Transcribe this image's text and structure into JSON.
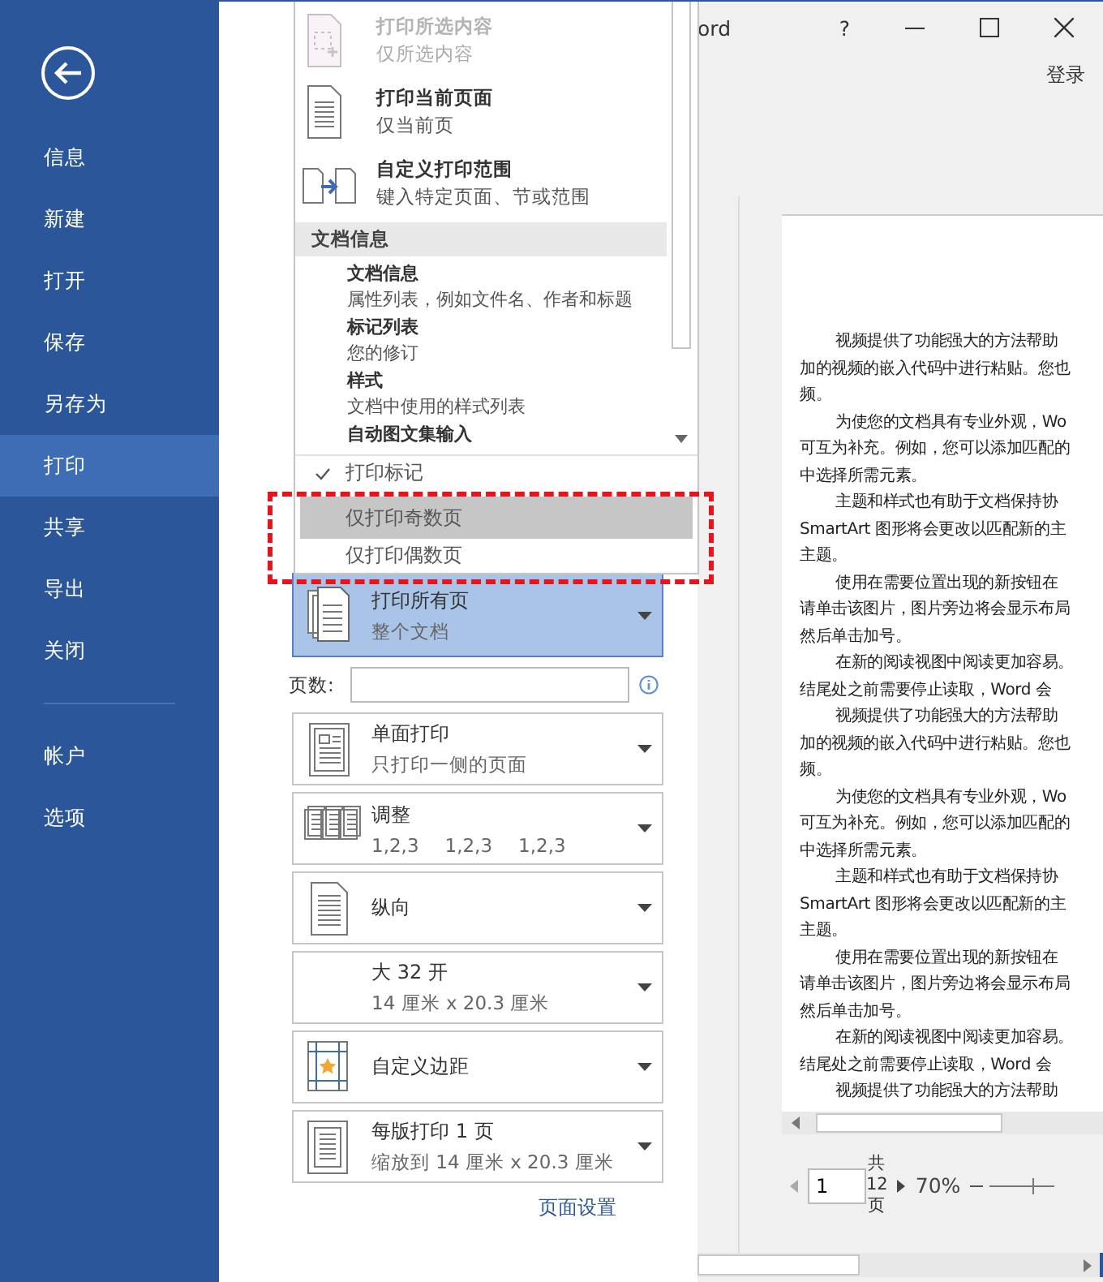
{
  "sidebar": {
    "items": [
      {
        "label": "信息",
        "selected": false
      },
      {
        "label": "新建",
        "selected": false
      },
      {
        "label": "打开",
        "selected": false
      },
      {
        "label": "保存",
        "selected": false
      },
      {
        "label": "另存为",
        "selected": false
      },
      {
        "label": "打印",
        "selected": true
      },
      {
        "label": "共享",
        "selected": false
      },
      {
        "label": "导出",
        "selected": false
      },
      {
        "label": "关闭",
        "selected": false
      }
    ],
    "footer_items": [
      {
        "label": "帐户",
        "selected": false
      },
      {
        "label": "选项",
        "selected": false
      }
    ]
  },
  "title_bar": {
    "title": "ord",
    "help": "?",
    "sign_in": "登录"
  },
  "print_settings": {
    "settings": [
      {
        "title": "打印所有页",
        "subtitle": "整个文档",
        "open": true
      },
      {
        "title": "单面打印",
        "subtitle": "只打印一侧的页面",
        "open": false
      },
      {
        "title": "调整",
        "subtitle_parts": [
          "1,2,3",
          "1,2,3",
          "1,2,3"
        ],
        "open": false
      },
      {
        "title": "纵向",
        "open": false
      },
      {
        "title": "大 32 开",
        "subtitle": "14 厘米 x 20.3 厘米",
        "open": false
      },
      {
        "title": "自定义边距",
        "open": false
      },
      {
        "title": "每版打印 1 页",
        "subtitle": "缩放到 14 厘米 x 20.3 厘米",
        "open": false
      }
    ],
    "pages_label": "页数:",
    "page_setup_link": "页面设置"
  },
  "menu": {
    "options": [
      {
        "title": "打印所选内容",
        "subtitle": "仅所选内容",
        "disabled": true
      },
      {
        "title": "打印当前页面",
        "subtitle": "仅当前页",
        "disabled": false
      },
      {
        "title": "自定义打印范围",
        "subtitle": "键入特定页面、节或范围",
        "disabled": false
      }
    ],
    "section": "文档信息",
    "list": [
      {
        "title": "文档信息",
        "subtitle": "属性列表，例如文件名、作者和标题"
      },
      {
        "title": "标记列表",
        "subtitle": "您的修订"
      },
      {
        "title": "样式",
        "subtitle": "文档中使用的样式列表"
      },
      {
        "title": "自动图文集输入"
      }
    ],
    "toggles": [
      {
        "label": "打印标记",
        "checked": true,
        "selected": false
      },
      {
        "label": "仅打印奇数页",
        "checked": false,
        "selected": true
      },
      {
        "label": "仅打印偶数页",
        "checked": false,
        "selected": false
      }
    ]
  },
  "preview": {
    "paragraphs": [
      [
        "视频提供了功能强大的方法帮助",
        "加的视频的嵌入代码中进行粘贴。您也",
        "频。"
      ],
      [
        "为使您的文档具有专业外观，Wo",
        "可互为补充。例如，您可以添加匹配的",
        "中选择所需元素。"
      ],
      [
        "主题和样式也有助于文档保持协",
        "SmartArt 图形将会更改以匹配新的主",
        "主题。"
      ],
      [
        "使用在需要位置出现的新按钮在",
        "请单击该图片，图片旁边将会显示布局",
        "然后单击加号。"
      ],
      [
        "在新的阅读视图中阅读更加容易。",
        "结尾处之前需要停止读取，Word 会"
      ],
      [
        "视频提供了功能强大的方法帮助",
        "加的视频的嵌入代码中进行粘贴。您也",
        "频。"
      ],
      [
        "为使您的文档具有专业外观，Wo",
        "可互为补充。例如，您可以添加匹配的",
        "中选择所需元素。"
      ],
      [
        "主题和样式也有助于文档保持协",
        "SmartArt 图形将会更改以匹配新的主",
        "主题。"
      ],
      [
        "使用在需要位置出现的新按钮在",
        "请单击该图片，图片旁边将会显示布局",
        "然后单击加号。"
      ],
      [
        "在新的阅读视图中阅读更加容易。",
        "结尾处之前需要停止读取，Word 会"
      ],
      [
        "视频提供了功能强大的方法帮助"
      ]
    ],
    "page_number": "1",
    "page_total": [
      "共",
      "12",
      "页"
    ],
    "zoom": "70%"
  }
}
